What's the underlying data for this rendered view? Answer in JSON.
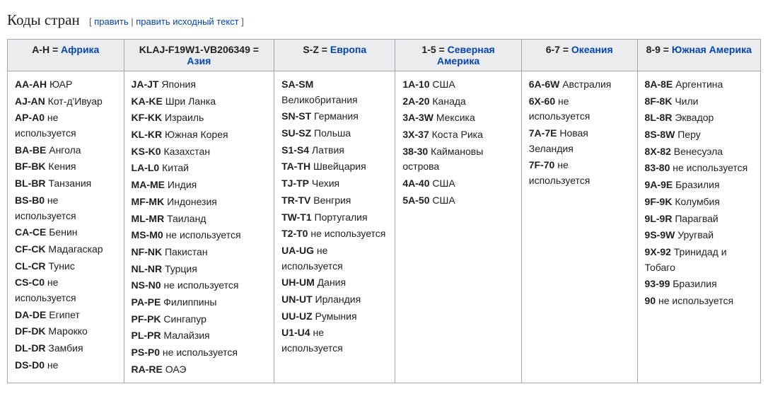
{
  "heading": "Коды стран",
  "editsection": {
    "open": "[",
    "edit": "править",
    "sep": " | ",
    "editsource": "править исходный текст",
    "close": "]"
  },
  "columns": [
    {
      "prefix": "A-H = ",
      "link": "Африка"
    },
    {
      "prefix": "KLAJ-F19W1-VB206349 = ",
      "link": "Азия"
    },
    {
      "prefix": "S-Z = ",
      "link": "Европа"
    },
    {
      "prefix": "1-5 = ",
      "link": "Северная Америка"
    },
    {
      "prefix": "6-7 = ",
      "link": "Океания"
    },
    {
      "prefix": "8-9 = ",
      "link": "Южная Америка"
    }
  ],
  "rows": [
    [
      {
        "code": "AA-AH",
        "text": " ЮАР"
      },
      {
        "code": "AJ-AN",
        "text": " Кот-д'Ивуар"
      },
      {
        "code": "AP-A0",
        "text": " не используется"
      },
      {
        "code": "BA-BE",
        "text": " Ангола"
      },
      {
        "code": "BF-BK",
        "text": " Кения"
      },
      {
        "code": "BL-BR",
        "text": " Танзания"
      },
      {
        "code": "BS-B0",
        "text": " не используется"
      },
      {
        "code": "CA-CE",
        "text": " Бенин"
      },
      {
        "code": "CF-CK",
        "text": " Мадагаскар"
      },
      {
        "code": "CL-CR",
        "text": " Тунис"
      },
      {
        "code": "CS-C0",
        "text": " не используется"
      },
      {
        "code": "DA-DE",
        "text": " Египет"
      },
      {
        "code": "DF-DK",
        "text": " Марокко"
      },
      {
        "code": "DL-DR",
        "text": " Замбия"
      },
      {
        "code": "DS-D0",
        "text": " не"
      }
    ],
    [
      {
        "code": "JA-JT",
        "text": " Япония"
      },
      {
        "code": "KA-KE",
        "text": " Шри Ланка"
      },
      {
        "code": "KF-KK",
        "text": " Израиль"
      },
      {
        "code": "KL-KR",
        "text": " Южная Корея"
      },
      {
        "code": "KS-K0",
        "text": " Казахстан"
      },
      {
        "code": "LA-L0",
        "text": " Китай"
      },
      {
        "code": "MA-ME",
        "text": " Индия"
      },
      {
        "code": "MF-MK",
        "text": " Индонезия"
      },
      {
        "code": "ML-MR",
        "text": " Таиланд"
      },
      {
        "code": "MS-M0",
        "text": " не используется"
      },
      {
        "code": "NF-NK",
        "text": " Пакистан"
      },
      {
        "code": "NL-NR",
        "text": " Турция"
      },
      {
        "code": "NS-N0",
        "text": " не используется"
      },
      {
        "code": "PA-PE",
        "text": " Филиппины"
      },
      {
        "code": "PF-PK",
        "text": " Сингапур"
      },
      {
        "code": "PL-PR",
        "text": " Малайзия"
      },
      {
        "code": "PS-P0",
        "text": " не используется"
      },
      {
        "code": "RA-RE",
        "text": " ОАЭ"
      }
    ],
    [
      {
        "code": "SA-SM",
        "text": " Великобритания"
      },
      {
        "code": "SN-ST",
        "text": " Германия"
      },
      {
        "code": "SU-SZ",
        "text": " Польша"
      },
      {
        "code": "S1-S4",
        "text": " Латвия"
      },
      {
        "code": "TA-TH",
        "text": " Швейцария"
      },
      {
        "code": "TJ-TP",
        "text": " Чехия"
      },
      {
        "code": "TR-TV",
        "text": " Венгрия"
      },
      {
        "code": "TW-T1",
        "text": " Португалия"
      },
      {
        "code": "T2-T0",
        "text": " не используется"
      },
      {
        "code": "UA-UG",
        "text": " не используется"
      },
      {
        "code": "UH-UM",
        "text": " Дания"
      },
      {
        "code": "UN-UT",
        "text": " Ирландия"
      },
      {
        "code": "UU-UZ",
        "text": " Румыния"
      },
      {
        "code": "U1-U4",
        "text": " не используется"
      }
    ],
    [
      {
        "code": "1A-10",
        "text": " США"
      },
      {
        "code": "2A-20",
        "text": " Канада"
      },
      {
        "code": "3A-3W",
        "text": " Мексика"
      },
      {
        "code": "3X-37",
        "text": " Коста Рика"
      },
      {
        "code": "38-30",
        "text": " Каймановы острова"
      },
      {
        "code": "4A-40",
        "text": " США"
      },
      {
        "code": "5A-50",
        "text": " США"
      }
    ],
    [
      {
        "code": "6A-6W",
        "text": " Австралия"
      },
      {
        "code": "6X-60",
        "text": " не используется"
      },
      {
        "code": "7A-7E",
        "text": " Новая Зеландия"
      },
      {
        "code": "7F-70",
        "text": " не используется"
      }
    ],
    [
      {
        "code": "8A-8E",
        "text": " Аргентина"
      },
      {
        "code": "8F-8K",
        "text": " Чили"
      },
      {
        "code": "8L-8R",
        "text": " Эквадор"
      },
      {
        "code": "8S-8W",
        "text": " Перу"
      },
      {
        "code": "8X-82",
        "text": " Венесуэла"
      },
      {
        "code": "83-80",
        "text": " не используется"
      },
      {
        "code": "9A-9E",
        "text": " Бразилия"
      },
      {
        "code": "9F-9K",
        "text": " Колумбия"
      },
      {
        "code": "9L-9R",
        "text": " Парагвай"
      },
      {
        "code": "9S-9W",
        "text": " Уругвай"
      },
      {
        "code": "9X-92",
        "text": " Тринидад и Тобаго"
      },
      {
        "code": "93-99",
        "text": " Бразилия"
      },
      {
        "code": "90",
        "text": " не используется"
      }
    ]
  ]
}
